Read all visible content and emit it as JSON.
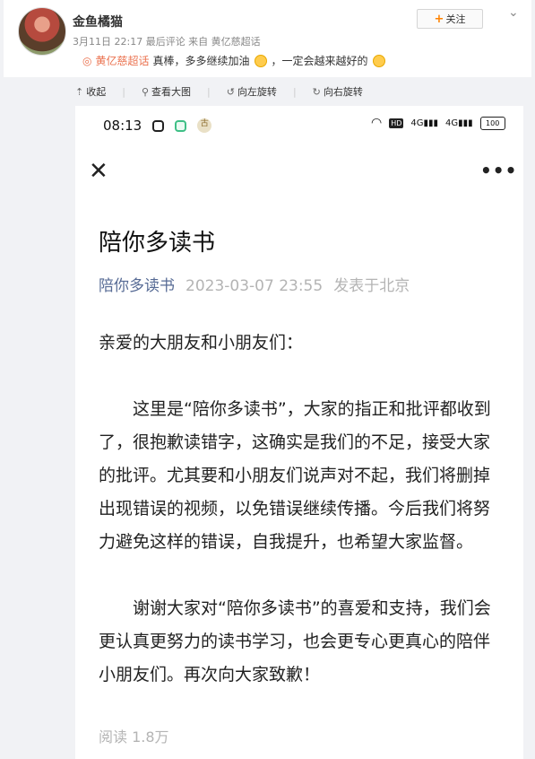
{
  "post": {
    "username": "金鱼橘猫",
    "meta": "3月11日 22:17 最后评论 来自 黄亿慈超话",
    "follow_label": "关注",
    "comment_source": "黄亿慈超话",
    "comment_text_1": "真棒，多多继续加油",
    "comment_text_2": "，一定会越来越好的"
  },
  "toolbar": {
    "collapse": "收起",
    "view_large": "查看大图",
    "rotate_left": "向左旋转",
    "rotate_right": "向右旋转"
  },
  "phone": {
    "time": "08:13",
    "network_1": "4G",
    "network_2": "4G",
    "battery": "100"
  },
  "article": {
    "title": "陪你多读书",
    "account": "陪你多读书",
    "datetime": "2023-03-07 23:55",
    "location": "发表于北京",
    "greeting": "亲爱的大朋友和小朋友们：",
    "paragraph_1": "这里是“陪你多读书”，大家的指正和批评都收到了，很抱歉读错字，这确实是我们的不足，接受大家的批评。尤其要和小朋友们说声对不起，我们将删掉出现错误的视频，以免错误继续传播。今后我们将努力避免这样的错误，自我提升，也希望大家监督。",
    "paragraph_2": "谢谢大家对“陪你多读书”的喜爱和支持，我们会更认真更努力的读书学习，也会更专心更真心的陪伴小朋友们。再次向大家致歉！",
    "reads": "阅读 1.8万"
  },
  "icons": [
    "avatar",
    "chevron-down-icon",
    "eye-icon",
    "emoji-icon",
    "collapse-icon",
    "search-icon",
    "rotate-left-icon",
    "rotate-right-icon",
    "instagram-icon",
    "app-icon",
    "close-icon",
    "more-icon",
    "wifi-icon",
    "signal-icon",
    "battery-icon"
  ]
}
